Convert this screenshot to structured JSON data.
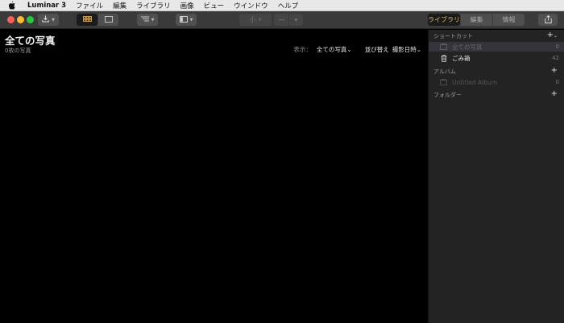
{
  "menubar": {
    "app_name": "Luminar 3",
    "items": [
      "ファイル",
      "編集",
      "ライブラリ",
      "画像",
      "ビュー",
      "ウインドウ",
      "ヘルプ"
    ]
  },
  "toolbar": {
    "size_label": "小",
    "minus_label": "—",
    "plus_label": "+",
    "tabs": [
      "ライブラリ",
      "編集",
      "情報"
    ]
  },
  "main": {
    "title": "全ての写真",
    "count": "0枚の写真",
    "view_label": "表示：",
    "view_value": "全ての写真",
    "sort_label": "並び替え",
    "sort_value": "撮影日時"
  },
  "sidebar": {
    "shortcuts_header": "ショートカット",
    "shortcuts": [
      {
        "name": "全ての写真",
        "count": "0"
      },
      {
        "name": "ごみ箱",
        "count": "42"
      }
    ],
    "albums_header": "アルバム",
    "albums": [
      {
        "name": "Untitled Album",
        "count": "0"
      }
    ],
    "folders_header": "フォルダー"
  },
  "colors": {
    "accent": "#e8b24a",
    "toolbar_bg": "#3a3a3a",
    "sidebar_bg": "#232323",
    "main_bg": "#000000"
  }
}
